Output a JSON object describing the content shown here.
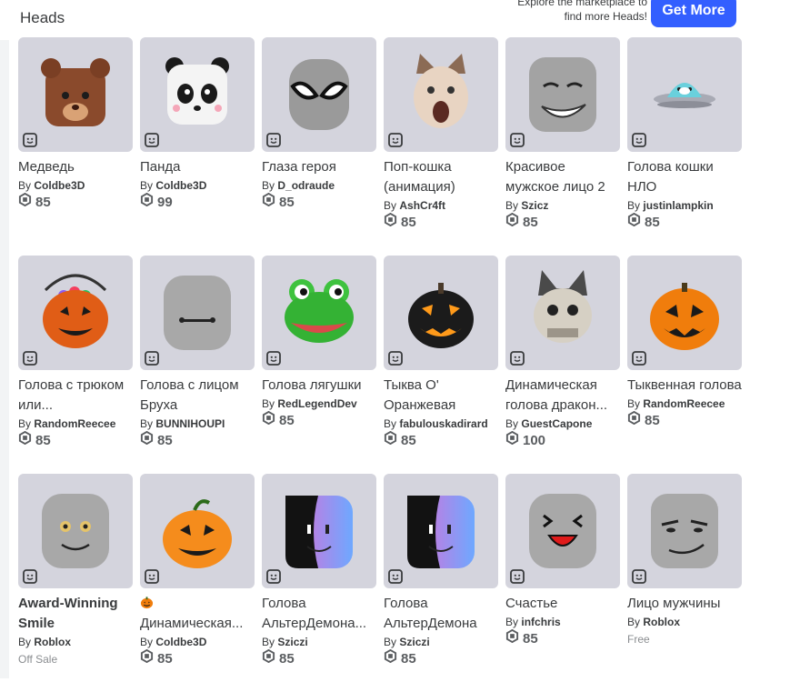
{
  "header": {
    "title": "Heads",
    "promo_line1": "Explore the marketplace to",
    "promo_line2": "find more Heads!",
    "get_more_label": "Get More"
  },
  "currency_icon": "robux-icon",
  "items": [
    {
      "name": "Медведь",
      "creator_prefix": "By",
      "creator": "Coldbe3D",
      "price": "85",
      "art": "bear"
    },
    {
      "name": "Панда",
      "creator_prefix": "By",
      "creator": "Coldbe3D",
      "price": "99",
      "art": "panda"
    },
    {
      "name": "Глаза героя",
      "creator_prefix": "By",
      "creator": "D_odraude",
      "price": "85",
      "art": "hero"
    },
    {
      "name": "Поп-кошка (анимация)",
      "creator_prefix": "By",
      "creator": "AshCr4ft",
      "price": "85",
      "art": "popcat"
    },
    {
      "name": "Красивое мужское лицо 2",
      "creator_prefix": "By",
      "creator": "Szicz",
      "price": "85",
      "art": "manface"
    },
    {
      "name": "Голова кошки НЛО",
      "creator_prefix": "By",
      "creator": "justinlampkin",
      "price": "85",
      "art": "ufo"
    },
    {
      "name": "Голова с трюком или...",
      "creator_prefix": "By",
      "creator": "RandomReecee",
      "price": "85",
      "art": "bucket"
    },
    {
      "name": "Голова с лицом Бруха",
      "creator_prefix": "By",
      "creator": "BUNNIHOUPI",
      "price": "85",
      "art": "bruh"
    },
    {
      "name": "Голова лягушки",
      "creator_prefix": "By",
      "creator": "RedLegendDev",
      "price": "85",
      "art": "frog"
    },
    {
      "name": "Тыква О' Оранжевая",
      "creator_prefix": "By",
      "creator": "fabulouskadirard",
      "price": "85",
      "art": "blackpumpkin"
    },
    {
      "name": "Динамическая голова дракон...",
      "creator_prefix": "By",
      "creator": "GuestCapone",
      "price": "100",
      "art": "dragon"
    },
    {
      "name": "Тыквенная голова",
      "creator_prefix": "By",
      "creator": "RandomReecee",
      "price": "85",
      "art": "pumpkin"
    },
    {
      "name": "Award-Winning Smile",
      "creator_prefix": "By",
      "creator": "Roblox",
      "status": "Off Sale",
      "bold": true,
      "art": "award"
    },
    {
      "name": "Динамическая...",
      "creator_prefix": "By",
      "creator": "Coldbe3D",
      "price": "85",
      "emoji": "pumpkin-emoji",
      "art": "pumpkin2"
    },
    {
      "name": "Голова АльтерДемона...",
      "creator_prefix": "By",
      "creator": "Sziczi",
      "price": "85",
      "art": "alter"
    },
    {
      "name": "Голова АльтерДемона",
      "creator_prefix": "By",
      "creator": "Sziczi",
      "price": "85",
      "art": "alter2"
    },
    {
      "name": "Счастье",
      "creator_prefix": "By",
      "creator": "infchris",
      "price": "85",
      "art": "happy"
    },
    {
      "name": "Лицо мужчины",
      "creator_prefix": "By",
      "creator": "Roblox",
      "status": "Free",
      "art": "manface2"
    }
  ]
}
